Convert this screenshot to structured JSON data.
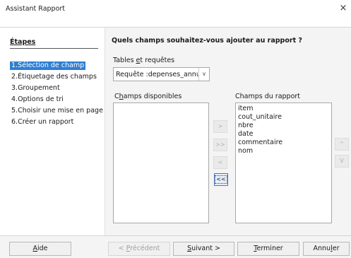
{
  "window": {
    "title": "Assistant Rapport",
    "close_glyph": "×"
  },
  "steps": {
    "title": "Étapes",
    "items": [
      {
        "label": "1.Sélection de champ",
        "active": true
      },
      {
        "label": "2.Étiquetage des champs",
        "active": false
      },
      {
        "label": "3.Groupement",
        "active": false
      },
      {
        "label": "4.Options de tri",
        "active": false
      },
      {
        "label": "5.Choisir une mise en page",
        "active": false
      },
      {
        "label": "6.Créer un rapport",
        "active": false
      }
    ]
  },
  "main": {
    "heading": "Quels champs souhaitez-vous ajouter au rapport ?",
    "tables_label_pre": "Tables ",
    "tables_label_u": "e",
    "tables_label_post": "t requêtes",
    "tables_select_value": "Requête :depenses_annuelle",
    "available_label_pre": "C",
    "available_label_u": "h",
    "available_label_post": "amps disponibles",
    "available_items": [],
    "report_label": "Champs du rapport",
    "report_items": [
      "item",
      "cout_unitaire",
      "nbre",
      "date",
      "commentaire",
      "nom"
    ],
    "move_buttons": {
      "add_one": ">",
      "add_all": ">>",
      "remove_one": "<",
      "remove_all": "<<"
    },
    "order_buttons": {
      "up": "^",
      "down": "V"
    }
  },
  "footer": {
    "help": {
      "pre": "",
      "u": "A",
      "post": "ide"
    },
    "previous": {
      "pre": "< ",
      "u": "P",
      "post": "récédent"
    },
    "next": {
      "pre": "",
      "u": "S",
      "post": "uivant >"
    },
    "finish": {
      "pre": "",
      "u": "T",
      "post": "erminer"
    },
    "cancel": {
      "pre": "Annu",
      "u": "l",
      "post": "er"
    }
  },
  "colors": {
    "accent": "#2f7fd4",
    "panel_bg": "#f4f4f4"
  }
}
